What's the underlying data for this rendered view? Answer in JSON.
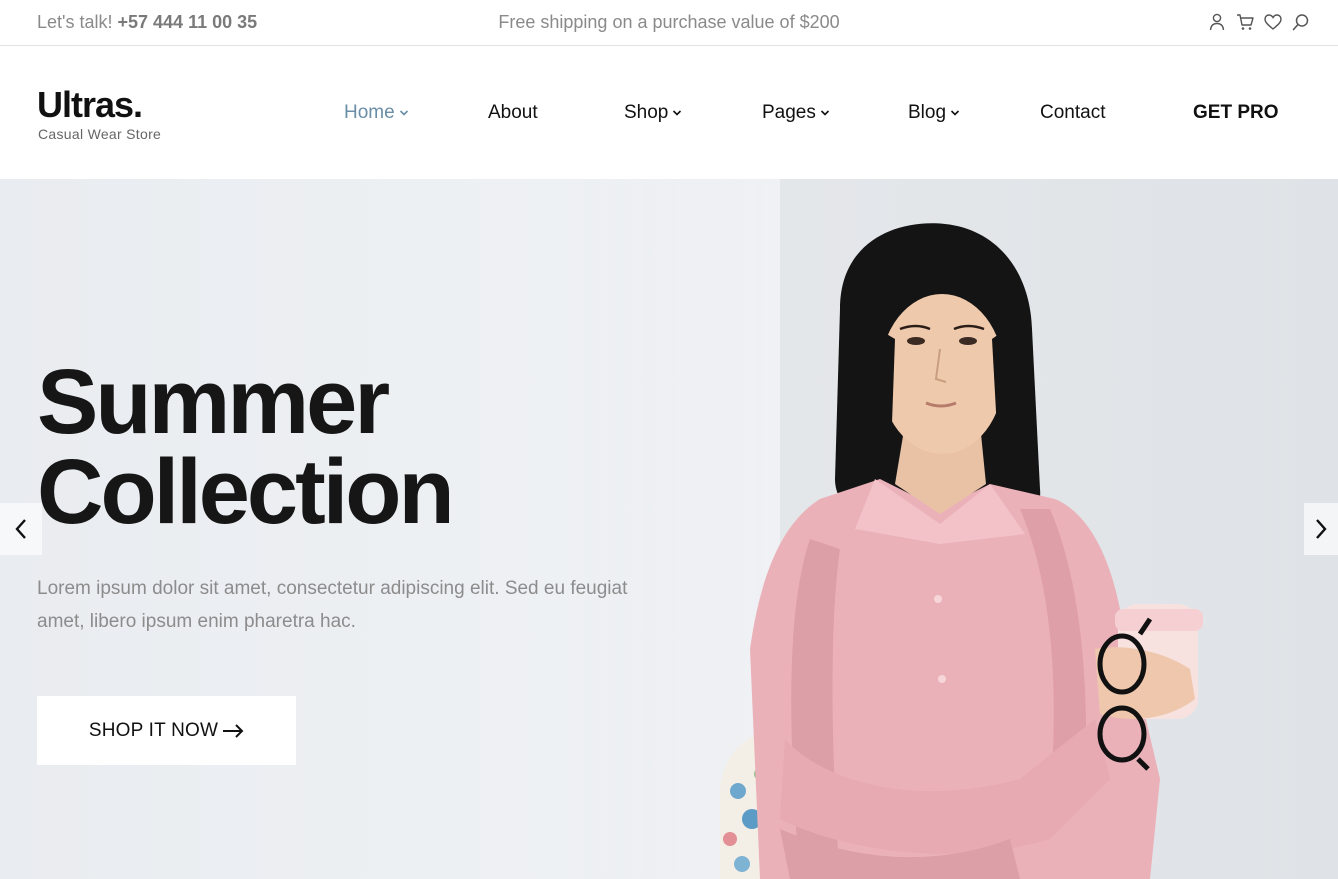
{
  "topbar": {
    "talk_label": "Let's talk!",
    "phone": "+57 444 11 00 35",
    "shipping": "Free shipping on a purchase value of $200",
    "icons": [
      "user-icon",
      "cart-icon",
      "heart-icon",
      "search-icon"
    ]
  },
  "header": {
    "logo": "Ultras.",
    "tagline": "Casual Wear Store",
    "nav": [
      {
        "label": "Home",
        "dropdown": true,
        "active": true
      },
      {
        "label": "About",
        "dropdown": false
      },
      {
        "label": "Shop",
        "dropdown": true
      },
      {
        "label": "Pages",
        "dropdown": true
      },
      {
        "label": "Blog",
        "dropdown": true
      },
      {
        "label": "Contact",
        "dropdown": false
      },
      {
        "label": "GET PRO",
        "dropdown": false
      }
    ]
  },
  "hero": {
    "title_line1": "Summer",
    "title_line2": "Collection",
    "description": "Lorem ipsum dolor sit amet, consectetur adipiscing elit. Sed eu feugiat amet, libero ipsum enim pharetra hac.",
    "cta_label": "SHOP IT NOW",
    "prev_icon": "chevron-left-icon",
    "next_icon": "chevron-right-icon"
  },
  "colors": {
    "accent_nav": "#6a8ea6",
    "text_muted": "#8c8c8c",
    "shirt_pink": "#eab0b8"
  }
}
